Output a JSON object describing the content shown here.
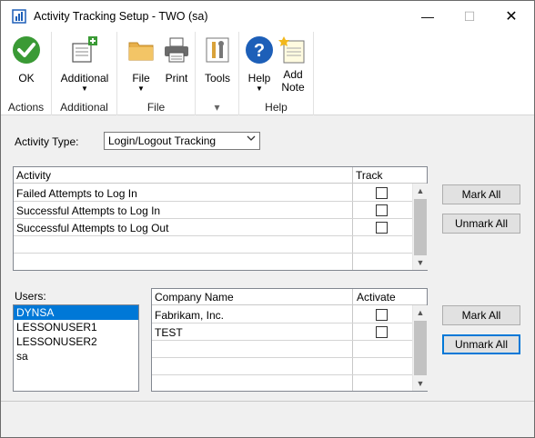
{
  "window": {
    "title": "Activity Tracking Setup  -  TWO (sa)"
  },
  "titlebar": {
    "min_glyph": "—",
    "max_glyph": "☐",
    "close_glyph": "✕"
  },
  "ribbon": {
    "groups": [
      {
        "label": "Actions",
        "buttons": [
          {
            "label": "OK",
            "icon": "ok-check-icon"
          }
        ]
      },
      {
        "label": "Additional",
        "buttons": [
          {
            "label": "Additional",
            "icon": "additional-add-icon",
            "dropdown": true
          }
        ]
      },
      {
        "label": "File",
        "buttons": [
          {
            "label": "File",
            "icon": "folder-icon",
            "dropdown": true
          },
          {
            "label": "Print",
            "icon": "printer-icon"
          }
        ]
      },
      {
        "label": "",
        "buttons": [
          {
            "label": "Tools",
            "icon": "tools-icon",
            "dropdown": true
          }
        ]
      },
      {
        "label": "Help",
        "buttons": [
          {
            "label": "Help",
            "icon": "help-question-icon",
            "dropdown": true
          },
          {
            "label": "Add\nNote",
            "icon": "add-note-icon"
          }
        ]
      }
    ],
    "dropdown_glyph": "▼",
    "tools_group_glyph": "▾"
  },
  "activity_type": {
    "label": "Activity Type:",
    "value": "Login/Logout Tracking"
  },
  "activity_grid": {
    "col_activity": "Activity",
    "col_track": "Track",
    "rows": [
      {
        "name": "Failed Attempts to Log In",
        "checked": false
      },
      {
        "name": "Successful Attempts to Log In",
        "checked": false
      },
      {
        "name": "Successful Attempts to Log Out",
        "checked": false
      },
      {
        "name": "",
        "checked": null
      },
      {
        "name": "",
        "checked": null
      }
    ]
  },
  "activity_buttons": {
    "mark_all": "Mark All",
    "unmark_all": "Unmark All"
  },
  "users": {
    "label": "Users:",
    "items": [
      "DYNSA",
      "LESSONUSER1",
      "LESSONUSER2",
      "sa"
    ],
    "selected": "DYNSA"
  },
  "company_grid": {
    "col_company": "Company Name",
    "col_activate": "Activate",
    "rows": [
      {
        "name": "Fabrikam, Inc.",
        "checked": false
      },
      {
        "name": "TEST",
        "checked": false
      },
      {
        "name": "",
        "checked": null
      },
      {
        "name": "",
        "checked": null
      },
      {
        "name": "",
        "checked": null
      }
    ]
  },
  "company_buttons": {
    "mark_all": "Mark All",
    "unmark_all": "Unmark All"
  },
  "scroll_glyphs": {
    "up": "▲",
    "down": "▼"
  },
  "colors": {
    "accent": "#0078d7",
    "ok_green": "#3a9a35",
    "help_blue": "#1d5fb8"
  }
}
